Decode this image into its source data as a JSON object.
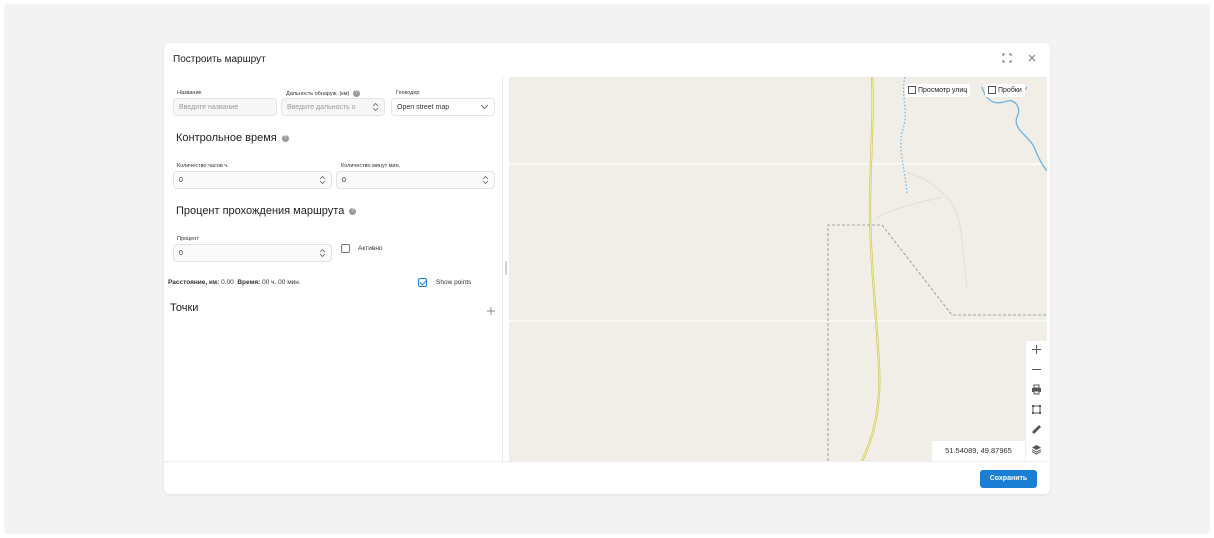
{
  "modal": {
    "title": "Построить маршрут",
    "fullscreen_icon": "fullscreen-icon",
    "close_icon": "close-icon"
  },
  "form": {
    "name_label": "Название",
    "name_placeholder": "Введите название",
    "range_label": "Дальность обнаруж. (км)",
    "range_placeholder": "Введите дальность о",
    "geocoder_label": "Геокодер",
    "geocoder_value": "Open street map",
    "control_time_heading": "Контрольное время",
    "hours_label": "Количество часов ч.",
    "hours_value": "0",
    "minutes_label": "Количество минут мин.",
    "minutes_value": "0",
    "percent_heading": "Процент прохождения маршрута",
    "percent_label": "Процент",
    "percent_value": "0",
    "active_label": "Активно",
    "active_checked": false,
    "distance_label": "Расстояние, км:",
    "distance_value": "0.00",
    "time_label": "Время:",
    "time_value": "00 ч. 00 мин.",
    "show_points_label": "Show points",
    "show_points_checked": true,
    "points_heading": "Точки",
    "add_point_icon": "plus-icon"
  },
  "map": {
    "street_view_label": "Просмотр улиц",
    "traffic_label": "Пробки",
    "coordinates": "51.54089, 49.87965",
    "controls": [
      "zoom-in-icon",
      "zoom-out-icon",
      "print-icon",
      "select-area-icon",
      "ruler-icon",
      "layers-icon"
    ]
  },
  "footer": {
    "save_label": "Сохранить"
  },
  "colors": {
    "accent": "#1a7ed4",
    "map_background": "#f1eee8",
    "river": "#6cb4e4",
    "road": "#d6d44a",
    "boundary": "#8c8c8c"
  }
}
